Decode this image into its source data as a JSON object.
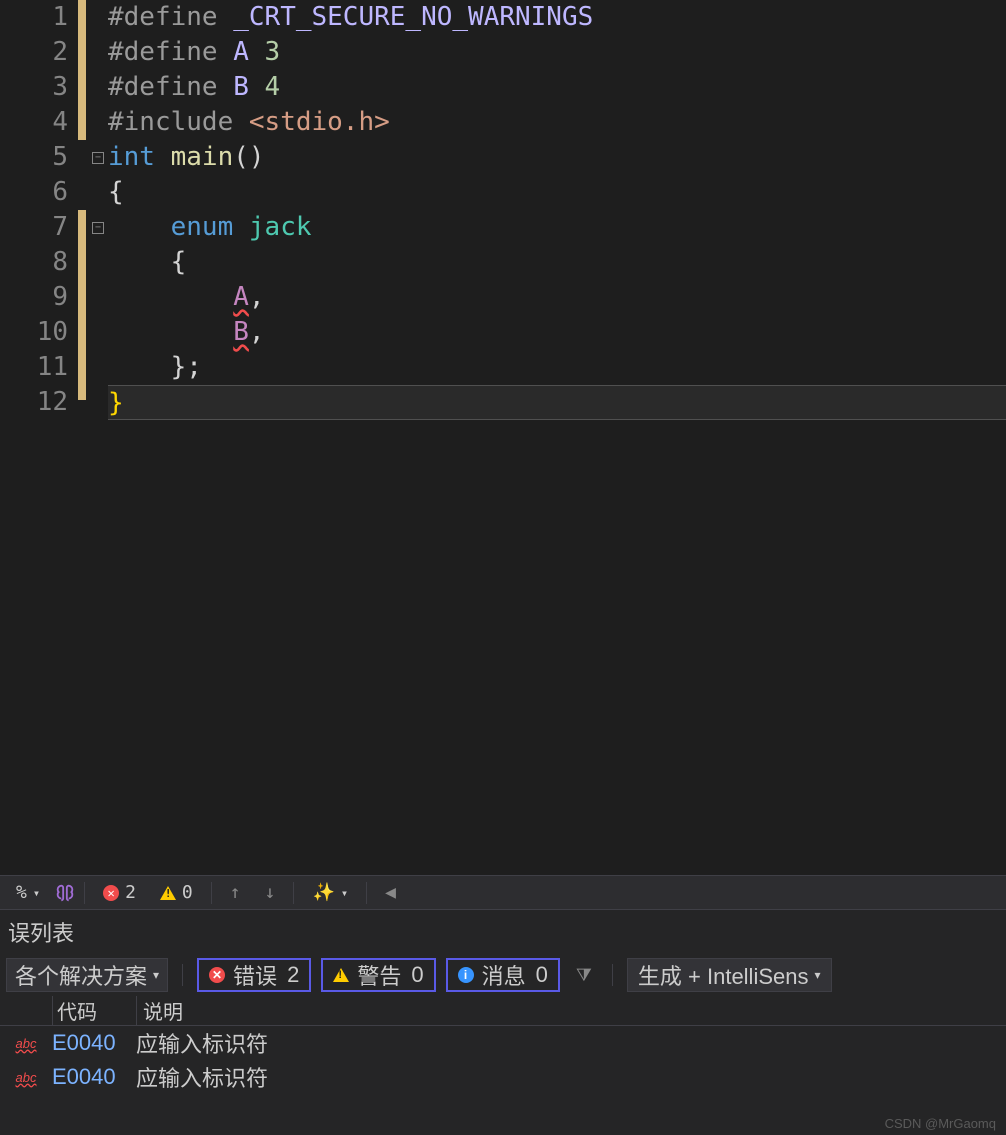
{
  "editor": {
    "lines": [
      {
        "no": 1
      },
      {
        "no": 2
      },
      {
        "no": 3
      },
      {
        "no": 4
      },
      {
        "no": 5
      },
      {
        "no": 6
      },
      {
        "no": 7
      },
      {
        "no": 8
      },
      {
        "no": 9
      },
      {
        "no": 10
      },
      {
        "no": 11
      },
      {
        "no": 12
      }
    ],
    "code": {
      "l1": {
        "pre": "#define",
        "sp1": " ",
        "macro": "_CRT_SECURE_NO_WARNINGS"
      },
      "l2": {
        "pre": "#define",
        "sp1": " ",
        "macro": "A",
        "sp2": " ",
        "num": "3"
      },
      "l3": {
        "pre": "#define",
        "sp1": " ",
        "macro": "B",
        "sp2": " ",
        "num": "4"
      },
      "l4": {
        "pre": "#include",
        "sp1": " ",
        "inc": "<stdio.h>"
      },
      "l5": {
        "kw": "int",
        "sp1": " ",
        "fn": "main",
        "par": "()"
      },
      "l6": {
        "brace": "{"
      },
      "l7": {
        "indent": "    ",
        "kw": "enum",
        "sp1": " ",
        "type": "jack"
      },
      "l8": {
        "indent": "    ",
        "brace": "{"
      },
      "l9": {
        "indent": "        ",
        "id": "A",
        "comma": ","
      },
      "l10": {
        "indent": "        ",
        "id": "B",
        "comma": ","
      },
      "l11": {
        "indent": "    ",
        "brace": "}",
        "semi": ";"
      },
      "l12": {
        "brace": "}"
      }
    }
  },
  "statusbar": {
    "zoom": "%",
    "errors": "2",
    "warnings": "0"
  },
  "errorPanel": {
    "title": "误列表",
    "scope": "各个解决方案",
    "toggles": {
      "errors_label": "错误",
      "errors_count": "2",
      "warnings_label": "警告",
      "warnings_count": "0",
      "messages_label": "消息",
      "messages_count": "0"
    },
    "source": "生成 + IntelliSens",
    "columns": {
      "code": "代码",
      "desc": "说明"
    },
    "rows": [
      {
        "code": "E0040",
        "desc": "应输入标识符"
      },
      {
        "code": "E0040",
        "desc": "应输入标识符"
      }
    ]
  },
  "watermark": "CSDN @MrGaomq"
}
